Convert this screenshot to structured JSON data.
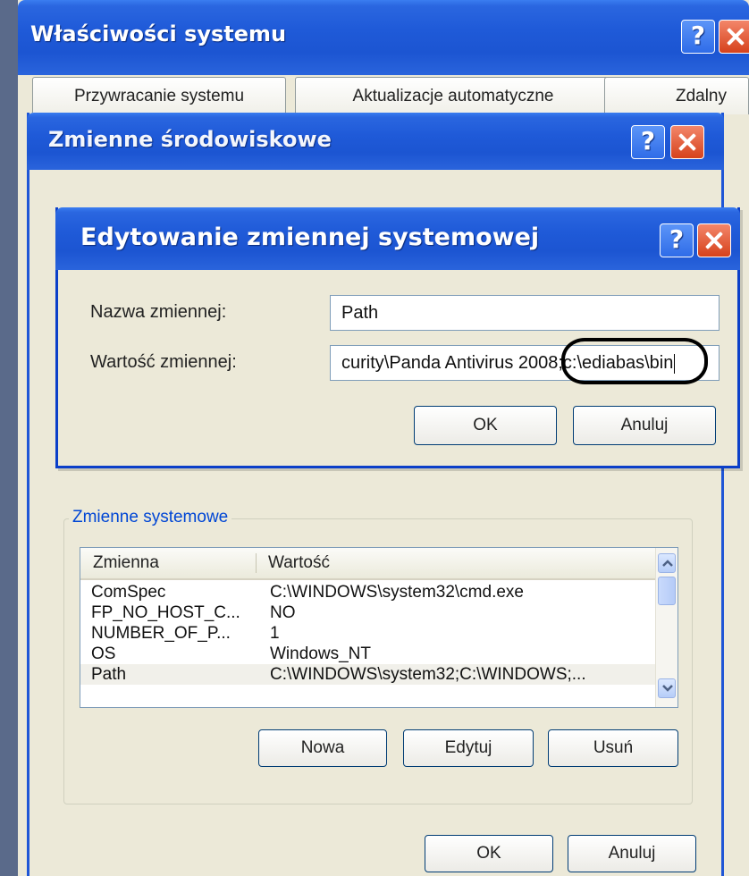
{
  "outer_window": {
    "title": "Właściwości systemu",
    "tabs": [
      "Przywracanie systemu",
      "Aktualizacje automatyczne",
      "Zdalny"
    ]
  },
  "env_window": {
    "title": "Zmienne środowiskowe",
    "system_group_label": "Zmienne systemowe",
    "list_headers": {
      "name": "Zmienna",
      "value": "Wartość"
    },
    "rows": [
      {
        "name": "ComSpec",
        "value": "C:\\WINDOWS\\system32\\cmd.exe"
      },
      {
        "name": "FP_NO_HOST_C...",
        "value": "NO"
      },
      {
        "name": "NUMBER_OF_P...",
        "value": "1"
      },
      {
        "name": "OS",
        "value": "Windows_NT"
      },
      {
        "name": "Path",
        "value": "C:\\WINDOWS\\system32;C:\\WINDOWS;..."
      }
    ],
    "buttons": {
      "new": "Nowa",
      "edit": "Edytuj",
      "delete": "Usuń",
      "ok": "OK",
      "cancel": "Anuluj"
    }
  },
  "edit_dialog": {
    "title": "Edytowanie zmiennej systemowej",
    "name_label": "Nazwa zmiennej:",
    "name_value": "Path",
    "value_label": "Wartość zmiennej:",
    "value_value": "curity\\Panda Antivirus 2008;c:\\ediabas\\bin",
    "ok": "OK",
    "cancel": "Anuluj"
  },
  "colors": {
    "title_bar": "#1f5ad8",
    "dialog_bg": "#ece9d8",
    "group_label": "#0046d5"
  }
}
